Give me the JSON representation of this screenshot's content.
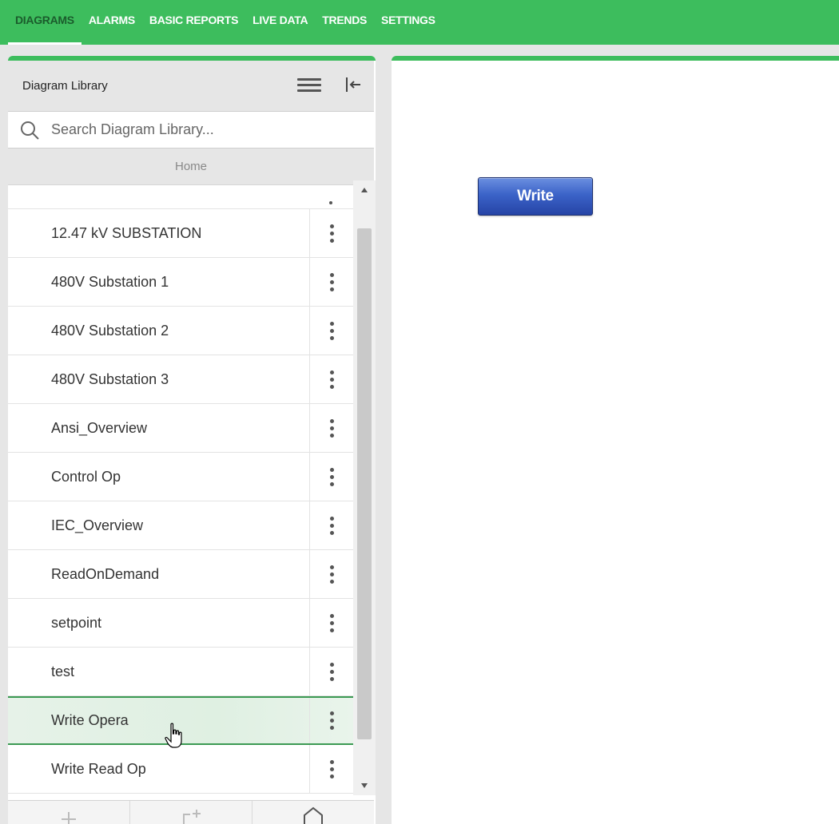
{
  "topnav": {
    "tabs": [
      {
        "label": "DIAGRAMS",
        "active": true
      },
      {
        "label": "ALARMS"
      },
      {
        "label": "BASIC REPORTS"
      },
      {
        "label": "LIVE DATA"
      },
      {
        "label": "TRENDS"
      },
      {
        "label": "SETTINGS"
      }
    ]
  },
  "library": {
    "title": "Diagram Library",
    "menu_icon": "hamburger-menu-icon",
    "collapse_icon": "collapse-left-icon",
    "search": {
      "placeholder": "Search Diagram Library...",
      "value": ""
    },
    "breadcrumb": "Home",
    "items": [
      {
        "label": "12.47 kV SUBSTATION"
      },
      {
        "label": "480V Substation 1"
      },
      {
        "label": "480V Substation 2"
      },
      {
        "label": "480V Substation 3"
      },
      {
        "label": "Ansi_Overview"
      },
      {
        "label": "Control Op"
      },
      {
        "label": "IEC_Overview"
      },
      {
        "label": "ReadOnDemand"
      },
      {
        "label": "setpoint"
      },
      {
        "label": "test"
      },
      {
        "label": "Write Opera",
        "hovered": true
      },
      {
        "label": "Write Read Op"
      }
    ],
    "footer_icons": [
      "add-icon",
      "add-folder-icon",
      "home-icon"
    ]
  },
  "canvas": {
    "write_button_label": "Write"
  },
  "colors": {
    "accent": "#3dbd5d",
    "button_blue": "#3b63c8"
  }
}
